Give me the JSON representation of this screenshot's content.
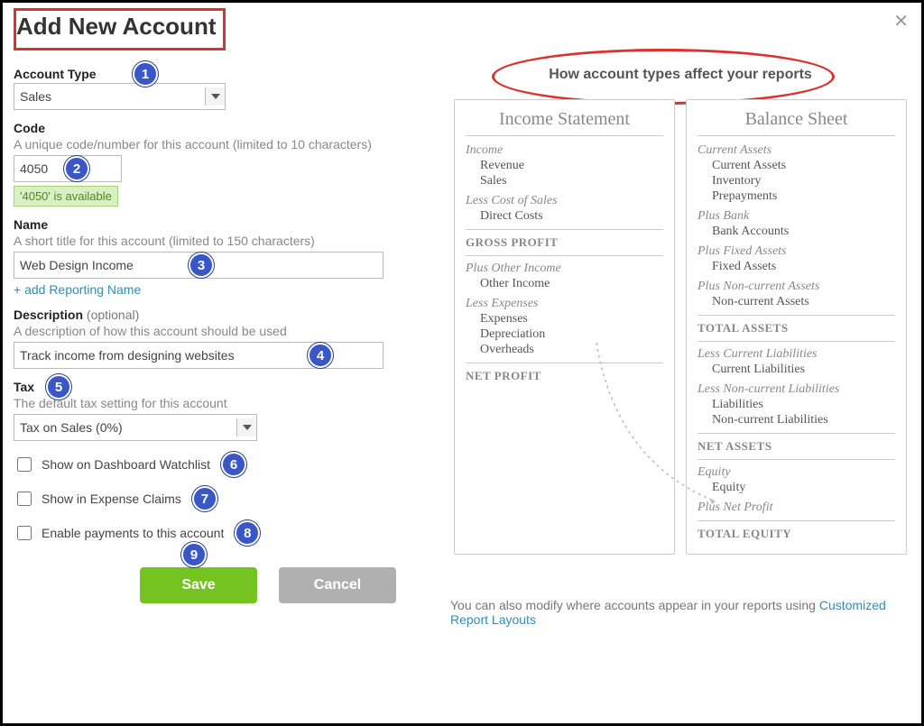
{
  "title": "Add New Account",
  "accountType": {
    "label": "Account Type",
    "value": "Sales"
  },
  "code": {
    "label": "Code",
    "helper": "A unique code/number for this account (limited to 10 characters)",
    "value": "4050",
    "availableMsg": "'4050' is available"
  },
  "name": {
    "label": "Name",
    "helper": "A short title for this account (limited to 150 characters)",
    "value": "Web Design Income",
    "addReporting": "+ add Reporting Name"
  },
  "description": {
    "label": "Description",
    "optional": "(optional)",
    "helper": "A description of how this account should be used",
    "value": "Track income from designing websites"
  },
  "tax": {
    "label": "Tax",
    "helper": "The default tax setting for this account",
    "value": "Tax on Sales (0%)"
  },
  "checks": {
    "watchlist": "Show on Dashboard Watchlist",
    "expense": "Show in Expense Claims",
    "payments": "Enable payments to this account"
  },
  "buttons": {
    "save": "Save",
    "cancel": "Cancel"
  },
  "info": {
    "title": "How account types affect your reports",
    "incomeStatement": {
      "heading": "Income Statement",
      "income": {
        "label": "Income",
        "items": [
          "Revenue",
          "Sales"
        ]
      },
      "costOfSales": {
        "label": "Less Cost of Sales",
        "items": [
          "Direct Costs"
        ]
      },
      "gross": "GROSS PROFIT",
      "otherIncome": {
        "label": "Plus Other Income",
        "items": [
          "Other Income"
        ]
      },
      "expenses": {
        "label": "Less Expenses",
        "items": [
          "Expenses",
          "Depreciation",
          "Overheads"
        ]
      },
      "net": "NET PROFIT"
    },
    "balanceSheet": {
      "heading": "Balance Sheet",
      "currentAssets": {
        "label": "Current Assets",
        "items": [
          "Current Assets",
          "Inventory",
          "Prepayments"
        ]
      },
      "bank": {
        "label": "Plus Bank",
        "items": [
          "Bank Accounts"
        ]
      },
      "fixed": {
        "label": "Plus Fixed Assets",
        "items": [
          "Fixed Assets"
        ]
      },
      "noncurrent": {
        "label": "Plus Non-current Assets",
        "items": [
          "Non-current Assets"
        ]
      },
      "totalAssets": "TOTAL ASSETS",
      "curLiab": {
        "label": "Less Current Liabilities",
        "items": [
          "Current Liabilities"
        ]
      },
      "nonCurLiab": {
        "label": "Less Non-current Liabilities",
        "items": [
          "Liabilities",
          "Non-current Liabilities"
        ]
      },
      "netAssets": "NET ASSETS",
      "equity": {
        "label": "Equity",
        "items": [
          "Equity"
        ]
      },
      "netProfit": "Plus Net Profit",
      "totalEquity": "TOTAL EQUITY"
    },
    "footer": {
      "text": "You can also modify where accounts appear in your reports using ",
      "link": "Customized Report Layouts"
    }
  },
  "badges": [
    "1",
    "2",
    "3",
    "4",
    "5",
    "6",
    "7",
    "8",
    "9"
  ]
}
